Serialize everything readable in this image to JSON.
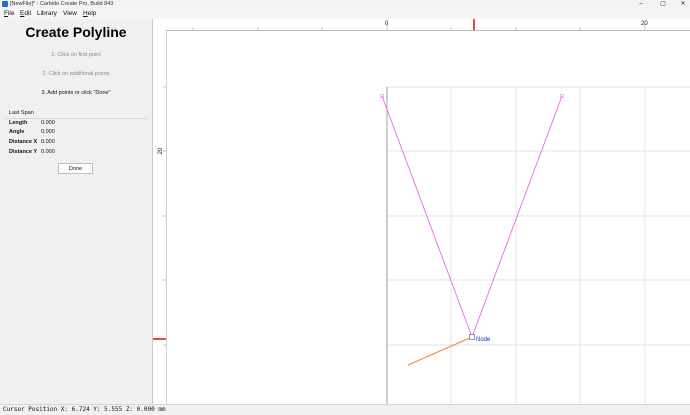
{
  "window": {
    "title": "[NewFile]* - Carbide Create Pro, Build 843",
    "controls": {
      "minimize": "–",
      "maximize": "▢",
      "close": "✕"
    }
  },
  "menu": [
    {
      "key": "F",
      "rest": "ile"
    },
    {
      "key": "E",
      "rest": "dit"
    },
    {
      "key": "",
      "rest": "Library"
    },
    {
      "key": "",
      "rest": "View"
    },
    {
      "key": "H",
      "rest": "elp"
    }
  ],
  "panel": {
    "title": "Create Polyline",
    "steps": [
      {
        "text": "1. Click on first point",
        "state": "done"
      },
      {
        "text": "2. Click on additional points",
        "state": "done"
      },
      {
        "text": "3. Add points or click \"Done\"",
        "state": "active"
      }
    ],
    "last_span": {
      "label": "Last Span",
      "rows": [
        {
          "label": "Length",
          "value": "0.000"
        },
        {
          "label": "Angle",
          "value": "0.000"
        },
        {
          "label": "Distance X",
          "value": "0.000"
        },
        {
          "label": "Distance Y",
          "value": "0.000"
        }
      ]
    },
    "done_label": "Done"
  },
  "rulers": {
    "horizontal_labels": [
      "0",
      "20"
    ],
    "vertical_labels": [
      "20"
    ]
  },
  "canvas": {
    "node_label": "Node",
    "colors": {
      "polyline": "#ee66ee",
      "preview_segment": "#e8874a",
      "node_label": "#1a33cc",
      "grid": "#dadada",
      "ruler_marker": "#cc0000",
      "stock_border": "#8a8a8a"
    }
  },
  "status": {
    "text": "Cursor Position X: 6.724 Y: 5.555 Z: 0.000 mm"
  }
}
